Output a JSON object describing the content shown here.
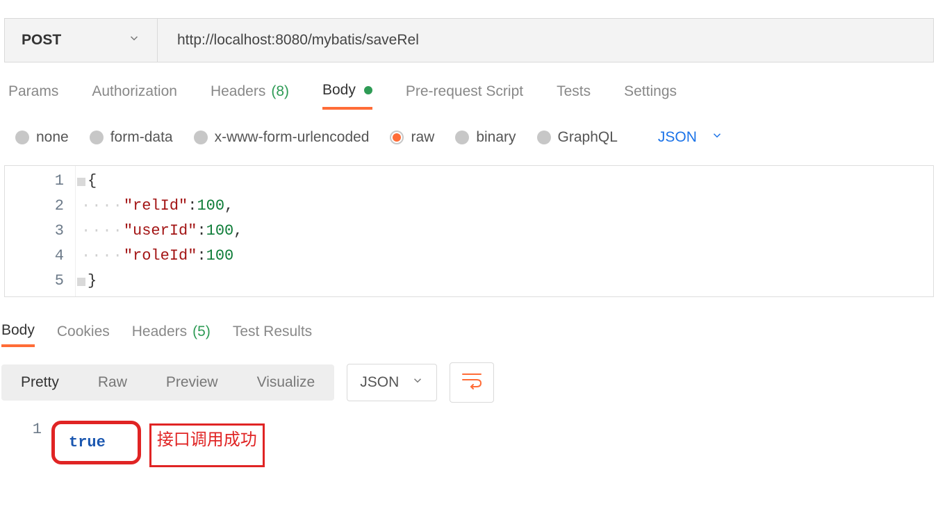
{
  "request": {
    "method": "POST",
    "url": "http://localhost:8080/mybatis/saveRel"
  },
  "reqTabs": {
    "params": "Params",
    "authorization": "Authorization",
    "headers_label": "Headers",
    "headers_count": "(8)",
    "body": "Body",
    "prerequest": "Pre-request Script",
    "tests": "Tests",
    "settings": "Settings"
  },
  "bodyRadios": {
    "none": "none",
    "formdata": "form-data",
    "xwww": "x-www-form-urlencoded",
    "raw": "raw",
    "binary": "binary",
    "graphql": "GraphQL"
  },
  "bodyType": "JSON",
  "editor": {
    "lines": [
      "1",
      "2",
      "3",
      "4",
      "5"
    ],
    "open": "{",
    "close": "}",
    "fields": [
      {
        "key": "\"relId\"",
        "value": "100",
        "comma": ","
      },
      {
        "key": "\"userId\"",
        "value": "100",
        "comma": ","
      },
      {
        "key": "\"roleId\"",
        "value": "100",
        "comma": ""
      }
    ]
  },
  "respTabs": {
    "body": "Body",
    "cookies": "Cookies",
    "headers_label": "Headers",
    "headers_count": "(5)",
    "testresults": "Test Results"
  },
  "respView": {
    "pretty": "Pretty",
    "raw": "Raw",
    "preview": "Preview",
    "visualize": "Visualize",
    "format": "JSON"
  },
  "response": {
    "line": "1",
    "value": "true"
  },
  "annotation": "接口调用成功"
}
